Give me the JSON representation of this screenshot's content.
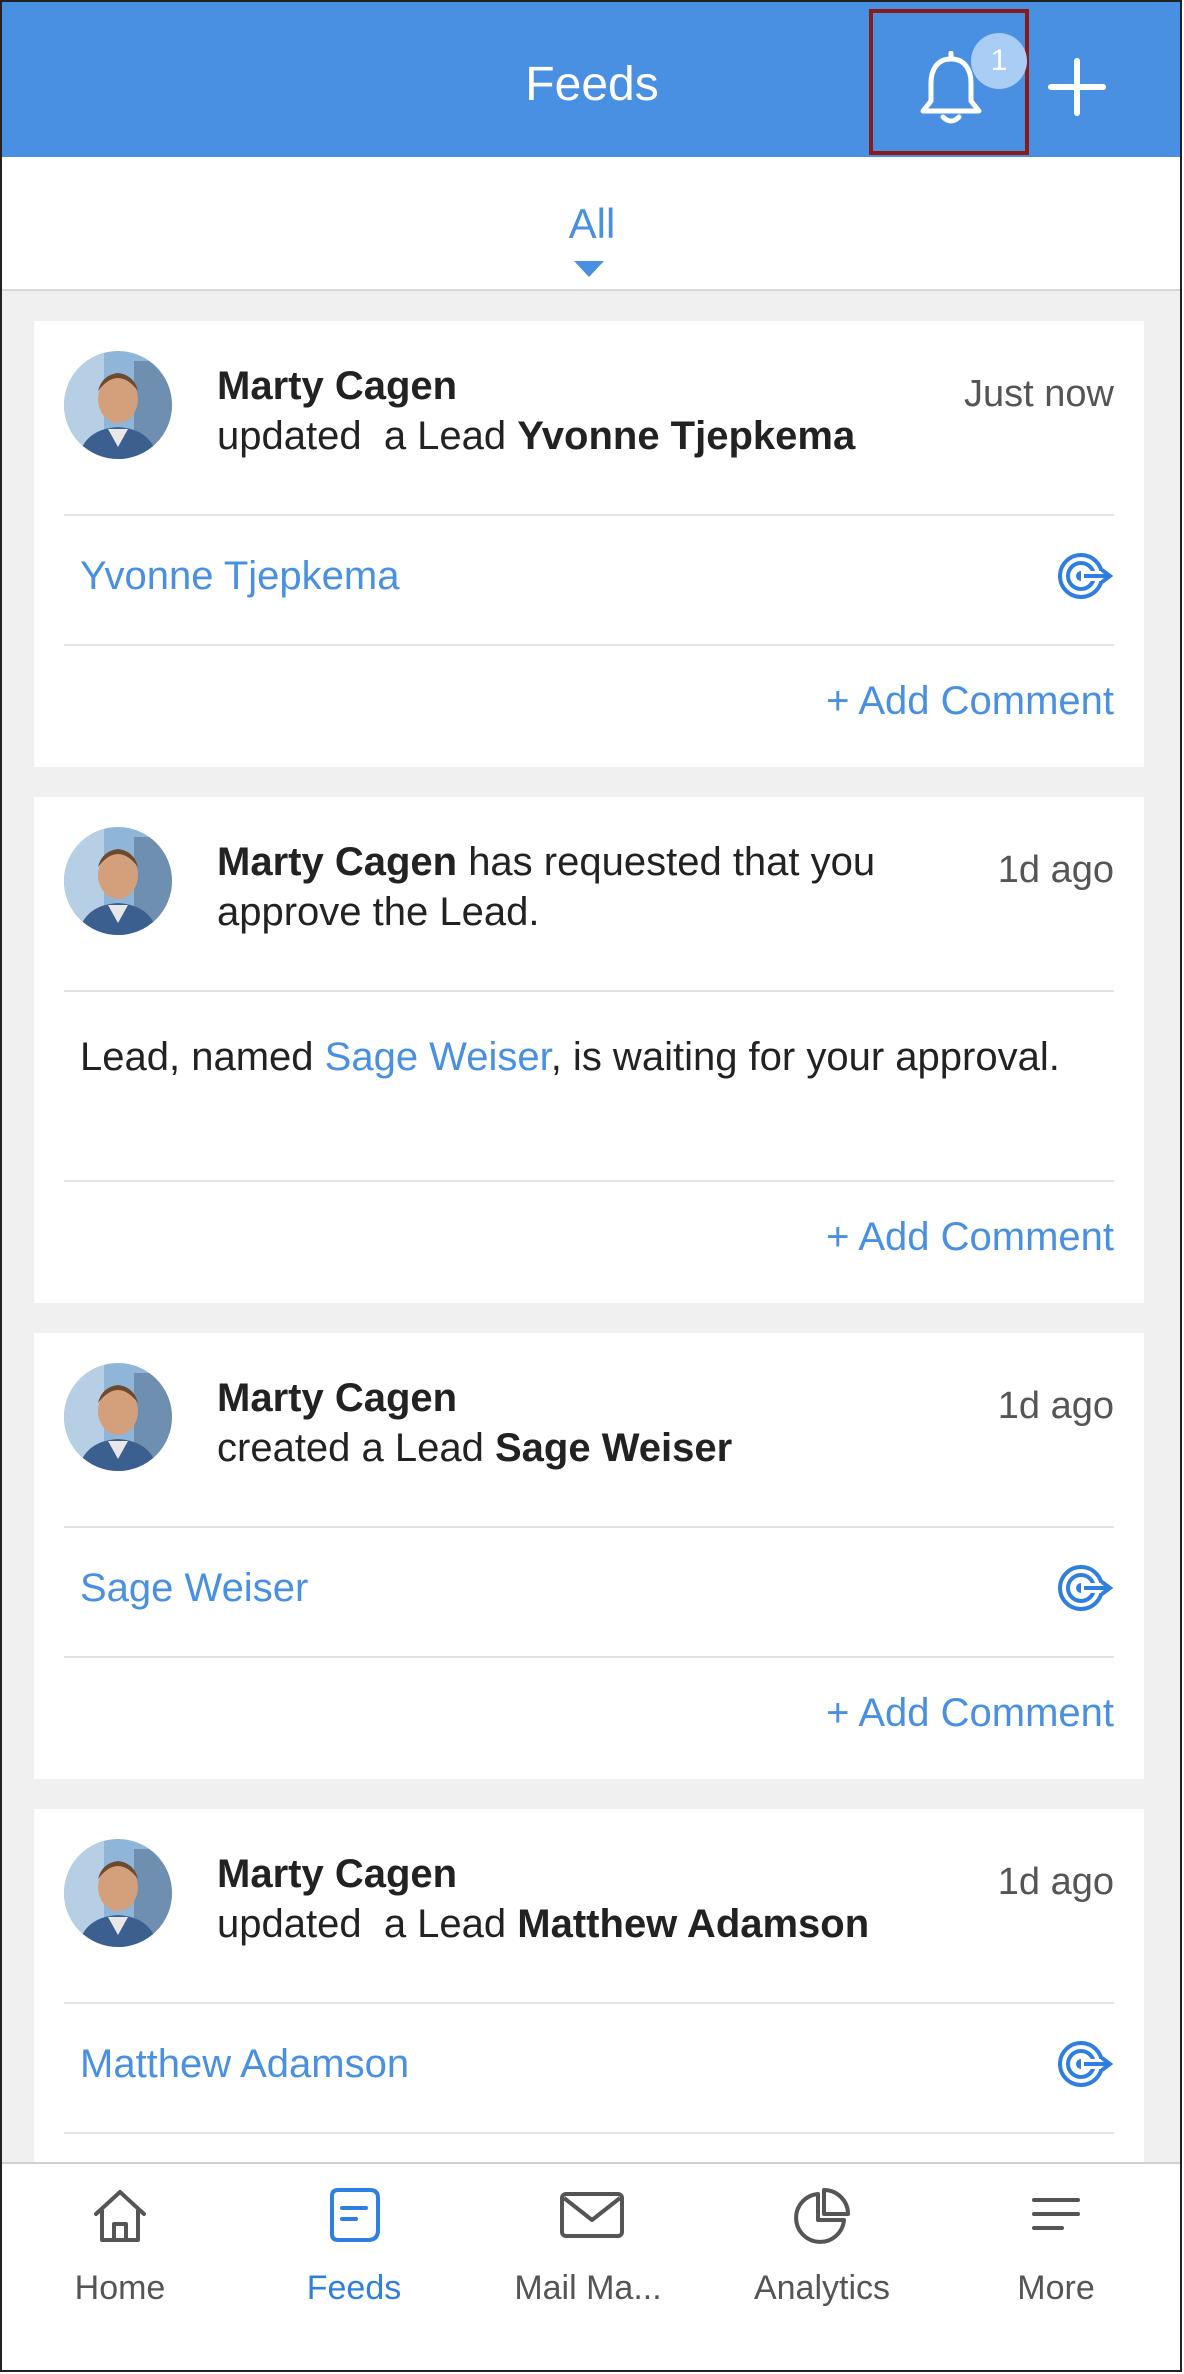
{
  "header": {
    "title": "Feeds",
    "notification_count": "1",
    "bell_icon": "bell-icon",
    "add_icon": "plus-icon"
  },
  "filter": {
    "selected": "All"
  },
  "colors": {
    "accent": "#4a90e2",
    "highlight_border": "#8b1a1a"
  },
  "feeds": [
    {
      "author": "Marty Cagen",
      "action": "updated  a Lead",
      "target": "Yvonne Tjepkema",
      "time": "Just now",
      "link": "Yvonne Tjepkema",
      "add_comment": "+ Add Comment"
    },
    {
      "author": "Marty Cagen",
      "action": "has requested that you approve the Lead.",
      "time": "1d ago",
      "body_prefix": "Lead, named ",
      "body_link": "Sage Weiser",
      "body_suffix": ", is waiting for your approval.",
      "add_comment": "+ Add Comment"
    },
    {
      "author": "Marty Cagen",
      "action": "created a Lead",
      "target": "Sage Weiser",
      "time": "1d ago",
      "link": "Sage Weiser",
      "add_comment": "+ Add Comment"
    },
    {
      "author": "Marty Cagen",
      "action": "updated  a Lead",
      "target": "Matthew Adamson",
      "time": "1d ago",
      "link": "Matthew Adamson"
    }
  ],
  "nav": [
    {
      "label": "Home",
      "icon": "home-icon"
    },
    {
      "label": "Feeds",
      "icon": "feeds-icon",
      "active": true
    },
    {
      "label": "Mail Ma...",
      "icon": "mail-icon"
    },
    {
      "label": "Analytics",
      "icon": "analytics-icon"
    },
    {
      "label": "More",
      "icon": "menu-icon"
    }
  ]
}
